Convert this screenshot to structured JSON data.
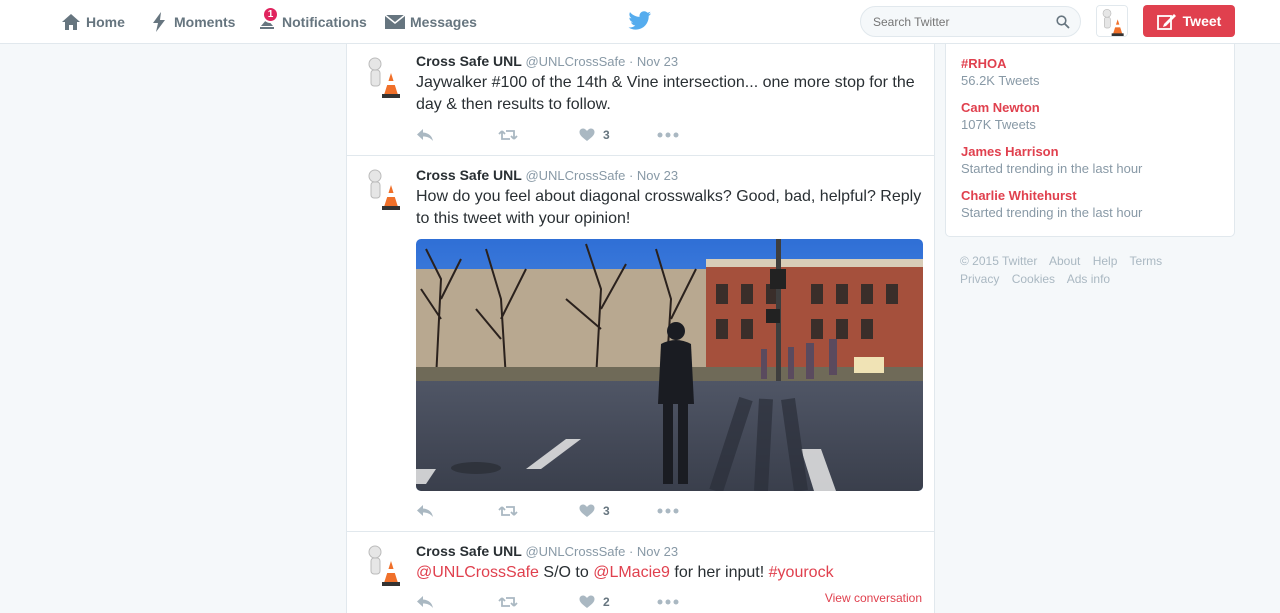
{
  "nav": {
    "home": "Home",
    "moments": "Moments",
    "notifications": "Notifications",
    "notifications_badge": "1",
    "messages": "Messages"
  },
  "search": {
    "placeholder": "Search Twitter"
  },
  "tweet_button": "Tweet",
  "tweets": [
    {
      "name": "Cross Safe UNL",
      "handle": "@UNLCrossSafe",
      "time": "· Nov 23",
      "text": "Jaywalker #100 of the 14th & Vine intersection... one more stop for the day & then results to follow.",
      "likes": "3"
    },
    {
      "name": "Cross Safe UNL",
      "handle": "@UNLCrossSafe",
      "time": "· Nov 23",
      "text": "How do you feel about diagonal crosswalks? Good, bad, helpful? Reply to this tweet with your opinion!",
      "likes": "3"
    },
    {
      "name": "Cross Safe UNL",
      "handle": "@UNLCrossSafe",
      "time": "· Nov 23",
      "text_parts": [
        "@UNLCrossSafe",
        " S/O to ",
        "@LMacie9",
        " for her input! ",
        "#yourock"
      ],
      "likes": "2",
      "view_conversation": "View conversation"
    }
  ],
  "trends": [
    {
      "name": "#RHOA",
      "meta": "56.2K Tweets"
    },
    {
      "name": "Cam Newton",
      "meta": "107K Tweets"
    },
    {
      "name": "James Harrison",
      "meta": "Started trending in the last hour"
    },
    {
      "name": "Charlie Whitehurst",
      "meta": "Started trending in the last hour"
    }
  ],
  "footer": {
    "line1": [
      "© 2015 Twitter",
      "About",
      "Help",
      "Terms"
    ],
    "line2": [
      "Privacy",
      "Cookies",
      "Ads info"
    ]
  },
  "colors": {
    "accent": "#e0404e",
    "muted": "#8899a6",
    "background": "#f5f8fa"
  }
}
